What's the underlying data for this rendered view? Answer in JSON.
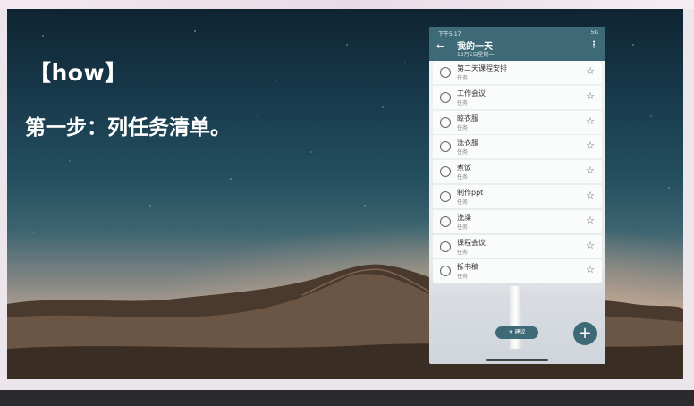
{
  "slide": {
    "heading": "【how】",
    "subheading": "第一步：列任务清单。"
  },
  "phone": {
    "status_time": "下午5:17",
    "status_right": "5G",
    "back_icon": "arrow-left-icon",
    "title": "我的一天",
    "date": "12月5日星期一",
    "menu_icon": "more-vertical-icon",
    "tasks": [
      {
        "name": "第二天课程安排",
        "sub": "任务"
      },
      {
        "name": "工作会议",
        "sub": "任务"
      },
      {
        "name": "晾衣服",
        "sub": "任务"
      },
      {
        "name": "洗衣服",
        "sub": "任务"
      },
      {
        "name": "煮饭",
        "sub": "任务"
      },
      {
        "name": "制作ppt",
        "sub": "任务"
      },
      {
        "name": "洗澡",
        "sub": "任务"
      },
      {
        "name": "课程会议",
        "sub": "任务"
      },
      {
        "name": "拆书稿",
        "sub": "任务"
      }
    ],
    "suggest_label": "建议",
    "fab_icon": "plus-icon"
  }
}
